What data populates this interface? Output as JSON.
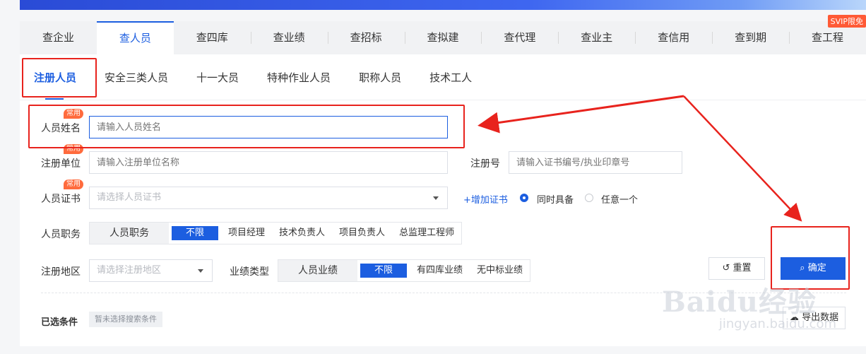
{
  "svip": "SVIP限免",
  "tabs": [
    "查企业",
    "查人员",
    "查四库",
    "查业绩",
    "查招标",
    "查拟建",
    "查代理",
    "查业主",
    "查信用",
    "查到期",
    "查工程"
  ],
  "subtabs": [
    "注册人员",
    "安全三类人员",
    "十一大员",
    "特种作业人员",
    "职称人员",
    "技术工人"
  ],
  "badge": "常用",
  "form": {
    "name_label": "人员姓名",
    "name_placeholder": "请输入人员姓名",
    "unit_label": "注册单位",
    "unit_placeholder": "请输入注册单位名称",
    "regno_label": "注册号",
    "regno_placeholder": "请输入证书编号/执业印章号",
    "cert_label": "人员证书",
    "cert_placeholder": "请选择人员证书",
    "add_cert": "+增加证书",
    "radio_both": "同时具备",
    "radio_any": "任意一个",
    "duty_label": "人员职务",
    "duty_head": "人员职务",
    "duty_options": [
      "不限",
      "项目经理",
      "技术负责人",
      "项目负责人",
      "总监理工程师"
    ],
    "region_label": "注册地区",
    "region_placeholder": "请选择注册地区",
    "perf_label": "业绩类型",
    "perf_head": "人员业绩",
    "perf_options": [
      "不限",
      "有四库业绩",
      "无中标业绩"
    ]
  },
  "buttons": {
    "reset": "重置",
    "confirm": "确定",
    "export": "导出数据"
  },
  "selected": {
    "label": "已选条件",
    "chip": "暂未选择搜索条件"
  },
  "watermark": {
    "main": "Baidu经验",
    "sub": "jingyan.baidu.com"
  },
  "colors": {
    "accent": "#1c5ee0",
    "badge": "#ff6b3d",
    "annotation": "#e8231d"
  }
}
